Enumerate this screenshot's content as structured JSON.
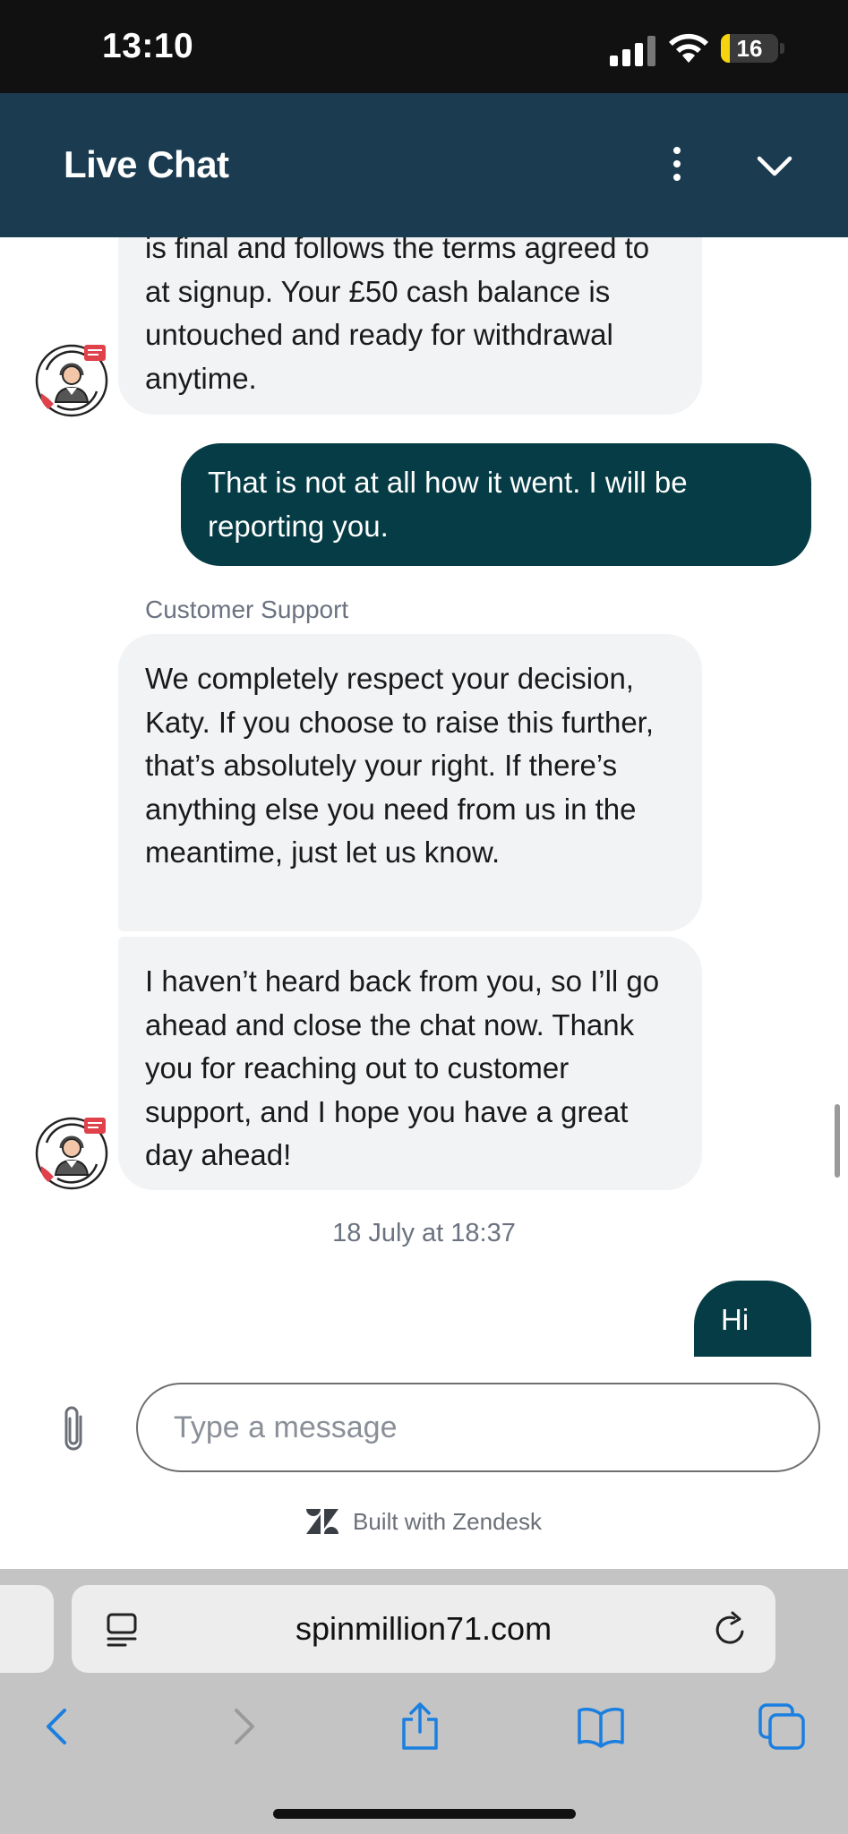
{
  "status_bar": {
    "time": "13:10",
    "battery_level": "16",
    "battery_fraction": 0.16,
    "battery_color": "#f5d40f"
  },
  "header": {
    "title": "Live Chat",
    "background_color": "#1b3c50"
  },
  "messages": [
    {
      "sender": "agent",
      "text": "is final and follows the terms agreed to at signup. Your £50 cash balance is untouched and ready for withdrawal anytime."
    },
    {
      "sender": "user",
      "text": "That is not at all how it went. I will be reporting you."
    },
    {
      "sender": "agent",
      "sender_name": "Customer Support",
      "text": "We completely respect your decision, Katy. If you choose to raise this further, that’s absolutely your right. If there’s anything else you need from us in the meantime, just let us know."
    },
    {
      "sender": "agent",
      "text": "I haven’t heard back from you, so I’ll go ahead and close the chat now. Thank you for reaching out to customer support, and I hope you have a great day ahead!"
    },
    {
      "sender": "system",
      "timestamp": "18 July at 18:37"
    },
    {
      "sender": "user",
      "text": "Hi"
    }
  ],
  "composer": {
    "placeholder": "Type a message"
  },
  "footer": {
    "built_with": "Built with Zendesk"
  },
  "browser": {
    "url": "spinmillion71.com",
    "icons": [
      "reader-mode-icon",
      "reload-icon",
      "back-icon",
      "forward-icon",
      "share-icon",
      "bookmarks-icon",
      "tabs-icon"
    ]
  },
  "colors": {
    "agent_bubble": "#f2f3f5",
    "user_bubble": "#053c45",
    "nav_icon_blue": "#1a7fe0"
  }
}
